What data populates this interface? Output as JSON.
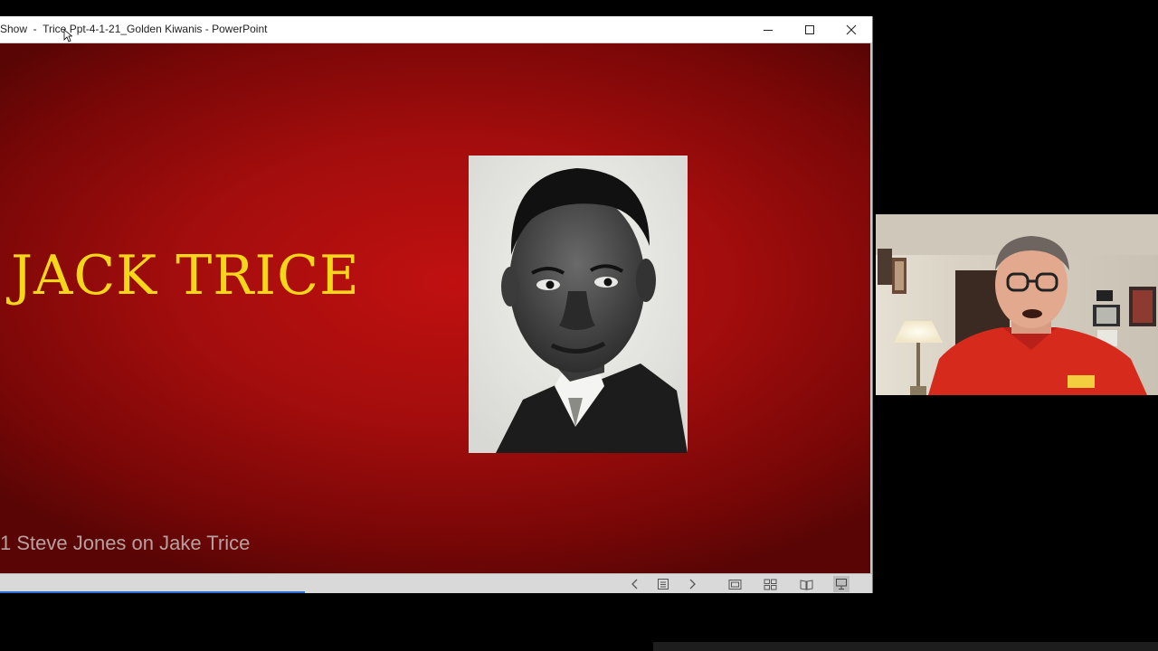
{
  "window": {
    "title": "Show  -  Trice Ppt-4-1-21_Golden Kiwanis - PowerPoint",
    "controls": {
      "minimize_icon": "minimize-icon",
      "maximize_icon": "maximize-icon",
      "close_icon": "close-icon"
    }
  },
  "slide": {
    "title": "JACK TRICE",
    "caption": "1 Steve Jones on Jake Trice",
    "background_color": "#a30d0d",
    "title_color": "#f5d71a",
    "photo_icon": "portrait-photo"
  },
  "statusbar": {
    "icons": [
      "previous-slide-icon",
      "slide-menu-icon",
      "next-slide-icon",
      "normal-view-icon",
      "slide-sorter-icon",
      "reading-view-icon",
      "slide-show-icon"
    ],
    "progress_fraction": 0.35
  },
  "webcam": {
    "icon": "webcam-video-feed"
  }
}
